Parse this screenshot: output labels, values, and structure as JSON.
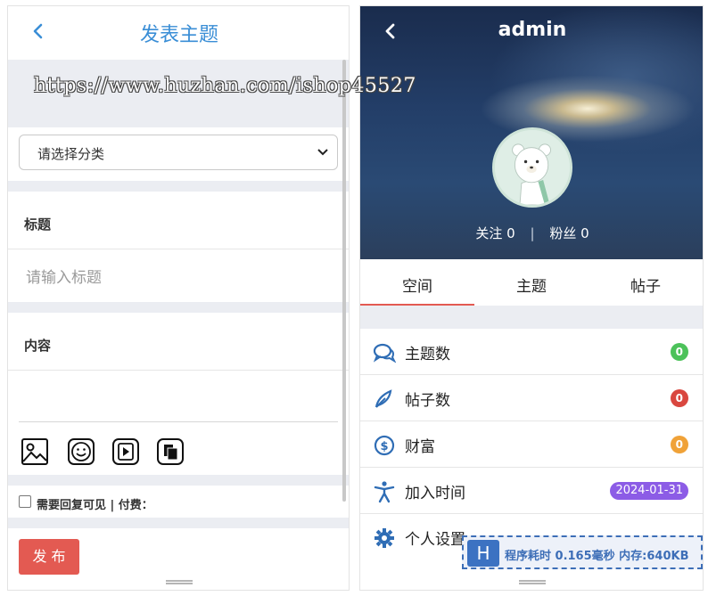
{
  "left": {
    "title": "发表主题",
    "category_select": {
      "selected": "请选择分类"
    },
    "title_label": "标题",
    "title_input": {
      "placeholder": "请输入标题"
    },
    "content_label": "内容",
    "toolbar": {
      "icons": [
        "image-icon",
        "emoji-icon",
        "video-icon",
        "file-icon"
      ]
    },
    "reply_visible_label": "需要回复可见 | 付费：",
    "publish_button": "发 布"
  },
  "right": {
    "username": "admin",
    "follow_label": "关注 0",
    "fans_label": "粉丝 0",
    "separator": "|",
    "tabs": [
      "空间",
      "主题",
      "帖子"
    ],
    "active_tab": 0,
    "rows": [
      {
        "label": "主题数",
        "value": "0",
        "badge_color": "#4cc25a",
        "icon": "chat-bubbles-icon"
      },
      {
        "label": "帖子数",
        "value": "0",
        "badge_color": "#d9473f",
        "icon": "feather-pen-icon"
      },
      {
        "label": "财富",
        "value": "0",
        "badge_color": "#f0a238",
        "icon": "coin-icon"
      },
      {
        "label": "加入时间",
        "value": "2024-01-31",
        "badge_color": "#8c5ce6",
        "icon": "person-icon"
      },
      {
        "label": "个人设置",
        "icon": "gear-icon"
      }
    ],
    "stats_logo": "H",
    "stats_text": "程序耗时 0.165毫秒 内存:640KB"
  },
  "watermark": "https://www.huzhan.com/ishop45527",
  "colors": {
    "accent_blue": "#3a8ed6",
    "publish_red": "#e35a52",
    "page_gray": "#ebedf2"
  }
}
